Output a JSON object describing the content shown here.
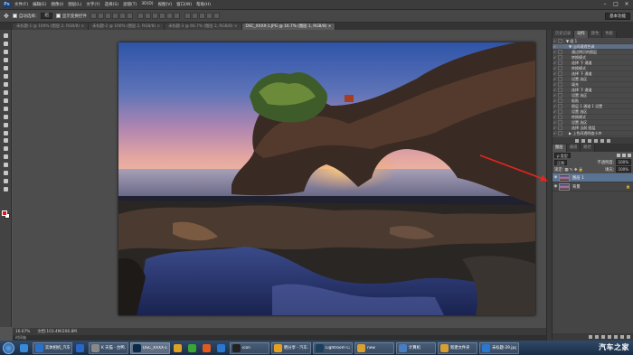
{
  "menubar": {
    "logo": "Ps",
    "items": [
      "文件(F)",
      "编辑(E)",
      "图像(I)",
      "图层(L)",
      "文字(Y)",
      "选择(S)",
      "滤镜(T)",
      "3D(D)",
      "视图(V)",
      "窗口(W)",
      "帮助(H)"
    ]
  },
  "options": {
    "auto_select": "自动选择：",
    "auto_select_value": "组",
    "transform": "显示变换控件",
    "workspace": "基本功能"
  },
  "tabs": [
    {
      "label": "未标题-1 @ 100% (图层 2, RGB/8) ×",
      "active": false
    },
    {
      "label": "未标题-2 @ 100% (图层 2, RGB/8) ×",
      "active": false
    },
    {
      "label": "未标题-3 @ 66.7% (图层 2, RGB/8) ×",
      "active": false
    },
    {
      "label": "DSC_XXXX-1.JPG @ 16.7% (图层 1, RGB/8) ×",
      "active": true
    }
  ],
  "status": {
    "zoom": "16.67%",
    "doc": "文档:103.4M/206.8M"
  },
  "mini_label": "时间轴",
  "actions_panel": {
    "tabs": [
      {
        "label": "历史记录",
        "active": false
      },
      {
        "label": "动作",
        "active": true
      },
      {
        "label": "颜色",
        "active": false
      },
      {
        "label": "色板",
        "active": false
      }
    ],
    "rows": [
      {
        "text": "▼ 组 1",
        "indent": 1,
        "selected": false
      },
      {
        "text": "▼ 山间通透色调",
        "indent": 2,
        "selected": true
      },
      {
        "text": "通过拷贝的图层",
        "indent": 3,
        "selected": false
      },
      {
        "text": "转换模式",
        "indent": 3,
        "selected": false
      },
      {
        "text": "选择 下 通道",
        "indent": 3,
        "selected": false
      },
      {
        "text": "转换模式",
        "indent": 3,
        "selected": false
      },
      {
        "text": "选择 下 通道",
        "indent": 3,
        "selected": false
      },
      {
        "text": "设置 选区",
        "indent": 3,
        "selected": false
      },
      {
        "text": "填充",
        "indent": 3,
        "selected": false
      },
      {
        "text": "选择 下 通道",
        "indent": 3,
        "selected": false
      },
      {
        "text": "设置 选区",
        "indent": 3,
        "selected": false
      },
      {
        "text": "粘贴",
        "indent": 3,
        "selected": false
      },
      {
        "text": "图层 1 通道 1 设置",
        "indent": 3,
        "selected": false
      },
      {
        "text": "设置 选区",
        "indent": 3,
        "selected": false
      },
      {
        "text": "转换模式",
        "indent": 3,
        "selected": false
      },
      {
        "text": "设置 选区",
        "indent": 3,
        "selected": false
      },
      {
        "text": "选择 当前 图层",
        "indent": 3,
        "selected": false
      },
      {
        "text": "▶ 上色间透明度小冲",
        "indent": 2,
        "selected": false
      }
    ]
  },
  "layers_panel": {
    "tabs": [
      {
        "label": "图层",
        "active": true
      },
      {
        "label": "通道",
        "active": false
      },
      {
        "label": "路径",
        "active": false
      }
    ],
    "kind": "ρ 类型",
    "blend": "正常",
    "opacity_label": "不透明度:",
    "opacity": "100%",
    "lock_label": "锁定:",
    "fill_label": "填充:",
    "fill": "100%",
    "layers": [
      {
        "name": "图层 1",
        "selected": true,
        "locked": false
      },
      {
        "name": "背景",
        "selected": false,
        "locked": true
      }
    ]
  },
  "taskbar": {
    "items": [
      {
        "label": "",
        "icon": "#3a88d8",
        "wide": false
      },
      {
        "label": "实体相机_汽车...",
        "icon": "#2b6fc9",
        "wide": true
      },
      {
        "label": "",
        "icon": "#2866c8",
        "wide": false
      },
      {
        "label": "K 天猫 - 台鸭...",
        "icon": "#888",
        "wide": true
      },
      {
        "label": "DSC_XXXX-1...",
        "icon": "#0b2a4a",
        "wide": true,
        "active": true
      },
      {
        "label": "",
        "icon": "#e0a020",
        "wide": false
      },
      {
        "label": "",
        "icon": "#3aa535",
        "wide": false
      },
      {
        "label": "",
        "icon": "#e05a20",
        "wide": false
      },
      {
        "label": "",
        "icon": "#2a77d0",
        "wide": false
      },
      {
        "label": "icon",
        "icon": "#222",
        "wide": true
      },
      {
        "label": "晒分享 - 汽车...",
        "icon": "#e5a020",
        "wide": true
      },
      {
        "label": "Lightroom Ca...",
        "icon": "#1c3f5c",
        "wide": true
      },
      {
        "label": "new",
        "icon": "#d8a030",
        "wide": true
      },
      {
        "label": "计算机",
        "icon": "#4a7dbf",
        "wide": true
      },
      {
        "label": "新建文件夹",
        "icon": "#d8a030",
        "wide": true
      },
      {
        "label": "未标题-29.jpg...",
        "icon": "#2a77d0",
        "wide": true
      }
    ],
    "watermark": "汽车之家"
  },
  "colors": {
    "foreground": "#e2151b",
    "background": "#ffffff",
    "arrow": "#e0281e"
  }
}
